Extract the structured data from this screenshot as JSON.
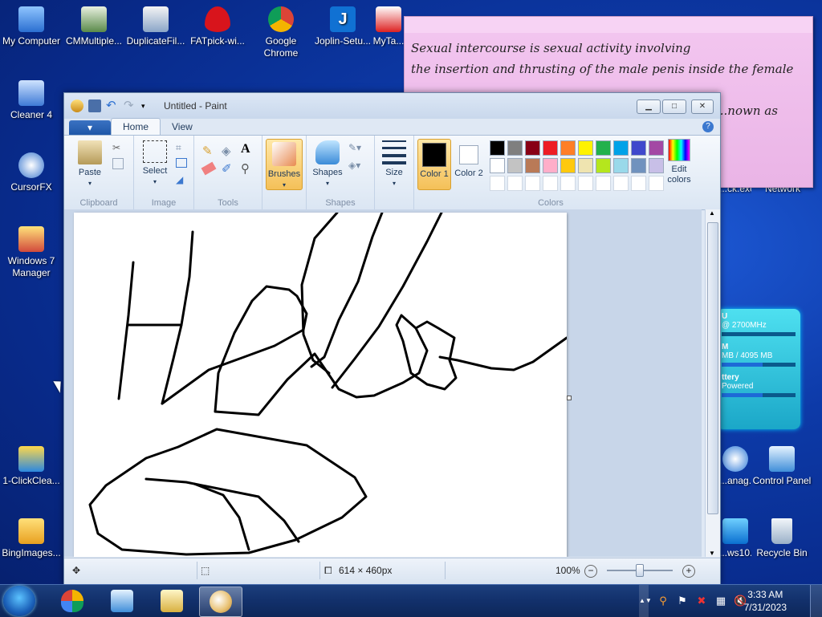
{
  "desktop": {
    "icons_left": [
      {
        "label": "My Computer"
      },
      {
        "label": "Cleaner 4"
      },
      {
        "label": "CursorFX"
      },
      {
        "label": "Windows 7 Manager"
      },
      {
        "label": "1-ClickClea..."
      },
      {
        "label": "BingImages..."
      }
    ],
    "icons_top": [
      {
        "label": "CMMultiple..."
      },
      {
        "label": "DuplicateFil..."
      },
      {
        "label": "FATpick-wi..."
      },
      {
        "label": "Google Chrome"
      },
      {
        "label": "Joplin-Setu..."
      },
      {
        "label": "MyTa..."
      }
    ],
    "icons_right": [
      {
        "label": "Control Panel"
      },
      {
        "label": "Recycle Bin"
      },
      {
        "label": "...anag..."
      },
      {
        "label": "...ws10..."
      }
    ],
    "partial_labels": {
      "exe": "...ck.exe",
      "network": "Network"
    }
  },
  "sticky_note": {
    "lines": [
      "Sexual intercourse is sexual activity involving",
      "the insertion and thrusting of the male penis inside the female",
      "",
      "...nown as"
    ]
  },
  "gadget": {
    "cpu_label": "U",
    "cpu_speed": "@ 2700MHz",
    "ram_label": "M",
    "ram_value": "MB / 4095 MB",
    "battery_label": "ttery",
    "battery_status": "Powered",
    "cpu_fraction": 0.0,
    "ram_fraction": 0.55,
    "battery_fraction": 0.55
  },
  "paint": {
    "title": "Untitled - Paint",
    "tabs": {
      "file": "▾",
      "home": "Home",
      "view": "View"
    },
    "help": "?",
    "ribbon": {
      "clipboard": {
        "paste": "Paste",
        "label": "Clipboard"
      },
      "image": {
        "select": "Select",
        "label": "Image"
      },
      "tools": {
        "label": "Tools"
      },
      "brushes": {
        "label": "Brushes"
      },
      "shapes": {
        "shapes": "Shapes",
        "label": "Shapes"
      },
      "size": {
        "label": "Size"
      },
      "colors": {
        "color1": "Color 1",
        "color2": "Color 2",
        "edit": "Edit colors",
        "label": "Colors",
        "color1_value": "#000000",
        "color2_value": "#ffffff",
        "palette_row1": [
          "#000000",
          "#7f7f7f",
          "#880015",
          "#ed1c24",
          "#ff7f27",
          "#fff200",
          "#22b14c",
          "#00a2e8",
          "#3f48cc",
          "#a349a4"
        ],
        "palette_row2": [
          "#ffffff",
          "#c3c3c3",
          "#b97a57",
          "#ffaec9",
          "#ffc90e",
          "#efe4b0",
          "#b5e61d",
          "#99d9ea",
          "#7092be",
          "#c8bfe7"
        ]
      }
    },
    "status": {
      "dimensions": "614 × 460px",
      "zoom": "100%"
    }
  },
  "taskbar": {
    "time": "3:33 AM",
    "date": "7/31/2023"
  }
}
